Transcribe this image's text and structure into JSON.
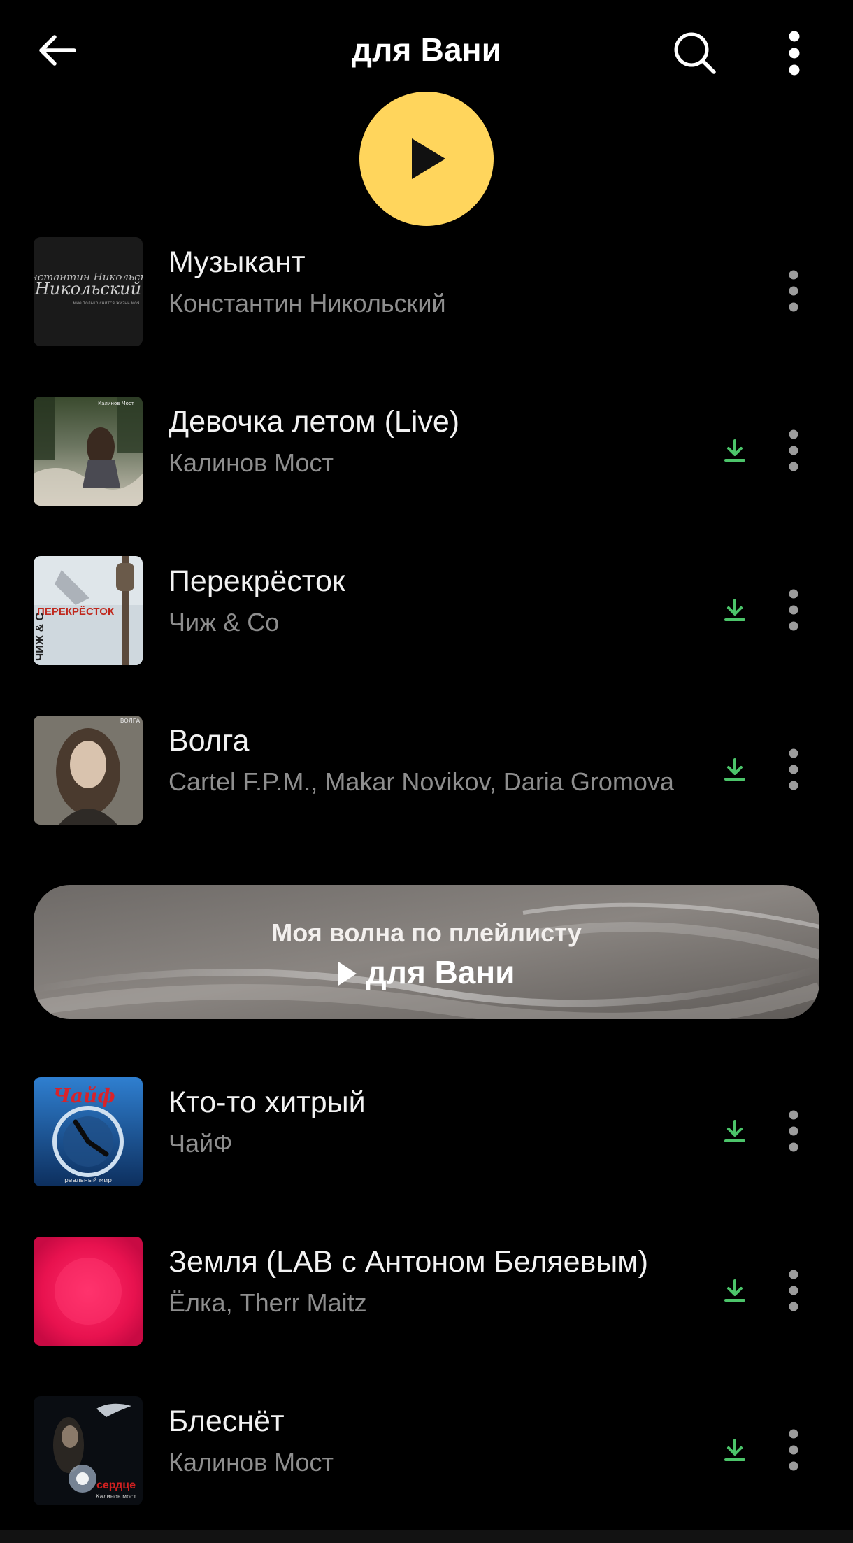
{
  "header": {
    "title": "для Вани",
    "back_icon": "arrow-left-icon",
    "search_icon": "search-icon",
    "menu_icon": "more-vertical-icon"
  },
  "play_button": {
    "icon": "play-icon",
    "color": "#ffd55c"
  },
  "tracks_top": [
    {
      "title": "Музыкант",
      "artist": "Константин Никольский",
      "downloaded": false
    },
    {
      "title": "Девочка летом (Live)",
      "artist": "Калинов Мост",
      "downloaded": true
    },
    {
      "title": "Перекрёсток",
      "artist": "Чиж & Co",
      "downloaded": true
    },
    {
      "title": "Волга",
      "artist": "Cartel F.P.M., Makar Novikov, Daria Gromova",
      "downloaded": true
    }
  ],
  "wave_banner": {
    "line1": "Моя волна по плейлисту",
    "line2": "для Вани"
  },
  "tracks_bottom": [
    {
      "title": "Кто-то хитрый",
      "artist": "ЧайФ",
      "downloaded": true
    },
    {
      "title": "Земля (LAB с Антоном Беляевым)",
      "artist": "Ёлка, Therr Maitz",
      "downloaded": true
    },
    {
      "title": "Блеснёт",
      "artist": "Калинов Мост",
      "downloaded": true
    }
  ],
  "colors": {
    "background": "#000000",
    "accent": "#ffd55c",
    "download": "#4cc46a",
    "secondary_text": "#8e8e8e"
  },
  "cover_art": {
    "cover_text_nikolsky": "Константин Никольский",
    "cover_text_perekrestok": "ПЕРЕКРЁСТОК",
    "cover_text_chizh": "ЧИЖ & С",
    "cover_text_volga": "ВОЛГА",
    "cover_text_chaif": "Чайф",
    "cover_text_chaif_sub": "реальный мир",
    "cover_text_serdce": "сердце",
    "cover_text_kalinov": "Калинов мост"
  }
}
